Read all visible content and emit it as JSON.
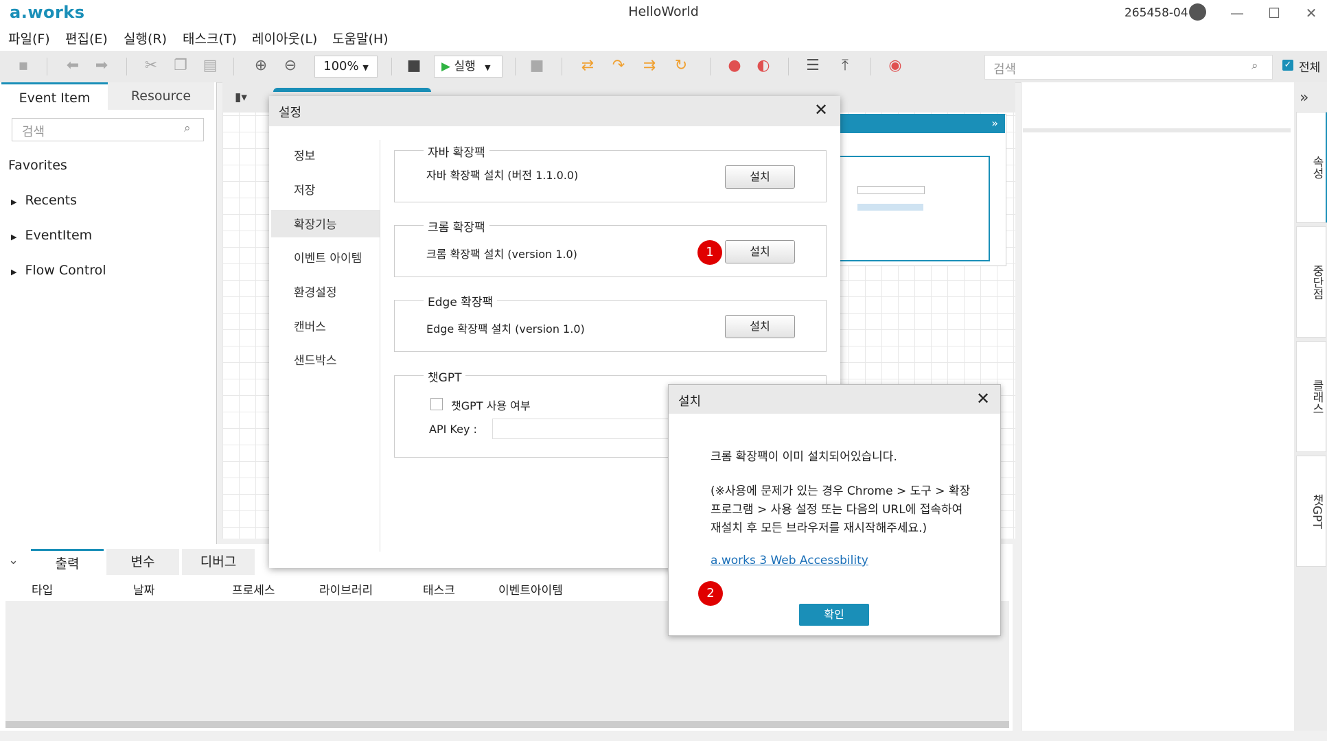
{
  "app": {
    "logo": "a.works",
    "title": "HelloWorld",
    "user_id": "265458-04"
  },
  "menu": [
    "파일(F)",
    "편집(E)",
    "실행(R)",
    "태스크(T)",
    "레이아웃(L)",
    "도움말(H)"
  ],
  "toolbar": {
    "zoom": "100%",
    "run_label": "실행",
    "search_placeholder": "검색",
    "all_label": "전체"
  },
  "left_panel": {
    "tabs": [
      "Event Item",
      "Resource"
    ],
    "search_placeholder": "검색",
    "favorites": "Favorites",
    "tree": [
      "Recents",
      "EventItem",
      "Flow Control"
    ]
  },
  "right_sidebar": {
    "tabs": [
      "속성",
      "중단점",
      "클래스",
      "챗GPT"
    ]
  },
  "bottom": {
    "tabs": [
      "출력",
      "변수",
      "디버그"
    ],
    "columns": [
      "타입",
      "날짜",
      "프로세스",
      "라이브러리",
      "태스크",
      "이벤트아이템"
    ]
  },
  "settings_dialog": {
    "title": "설정",
    "nav": [
      "정보",
      "저장",
      "확장기능",
      "이벤트 아이템",
      "환경설정",
      "캔버스",
      "샌드박스"
    ],
    "selected_nav": "확장기능",
    "groups": [
      {
        "title": "자바 확장팩",
        "text": "자바 확장팩 설치 (버전 1.1.0.0)",
        "button": "설치"
      },
      {
        "title": "크롬 확장팩",
        "text": "크롬 확장팩 설치 (version 1.0)",
        "button": "설치"
      },
      {
        "title": "Edge 확장팩",
        "text": "Edge 확장팩 설치 (version 1.0)",
        "button": "설치"
      }
    ],
    "chatgpt": {
      "title": "챗GPT",
      "checkbox_label": "챗GPT 사용 여부",
      "api_key_label": "API Key :"
    },
    "badge_1": "1"
  },
  "install_popup": {
    "title": "설치",
    "message": "크롬 확장팩이 이미 설치되어있습니다.",
    "detail_lines": [
      "(※사용에 문제가 있는 경우 Chrome > 도구 > 확장",
      "프로그램 > 사용 설정 또는 다음의 URL에 접속하여",
      "재설치 후 모든 브라우저를 재시작해주세요.)"
    ],
    "link": "a.works 3 Web Accessbility",
    "ok_button": "확인",
    "badge_2": "2"
  },
  "colors": {
    "accent": "#1a8fb8",
    "badge": "#e00000"
  }
}
